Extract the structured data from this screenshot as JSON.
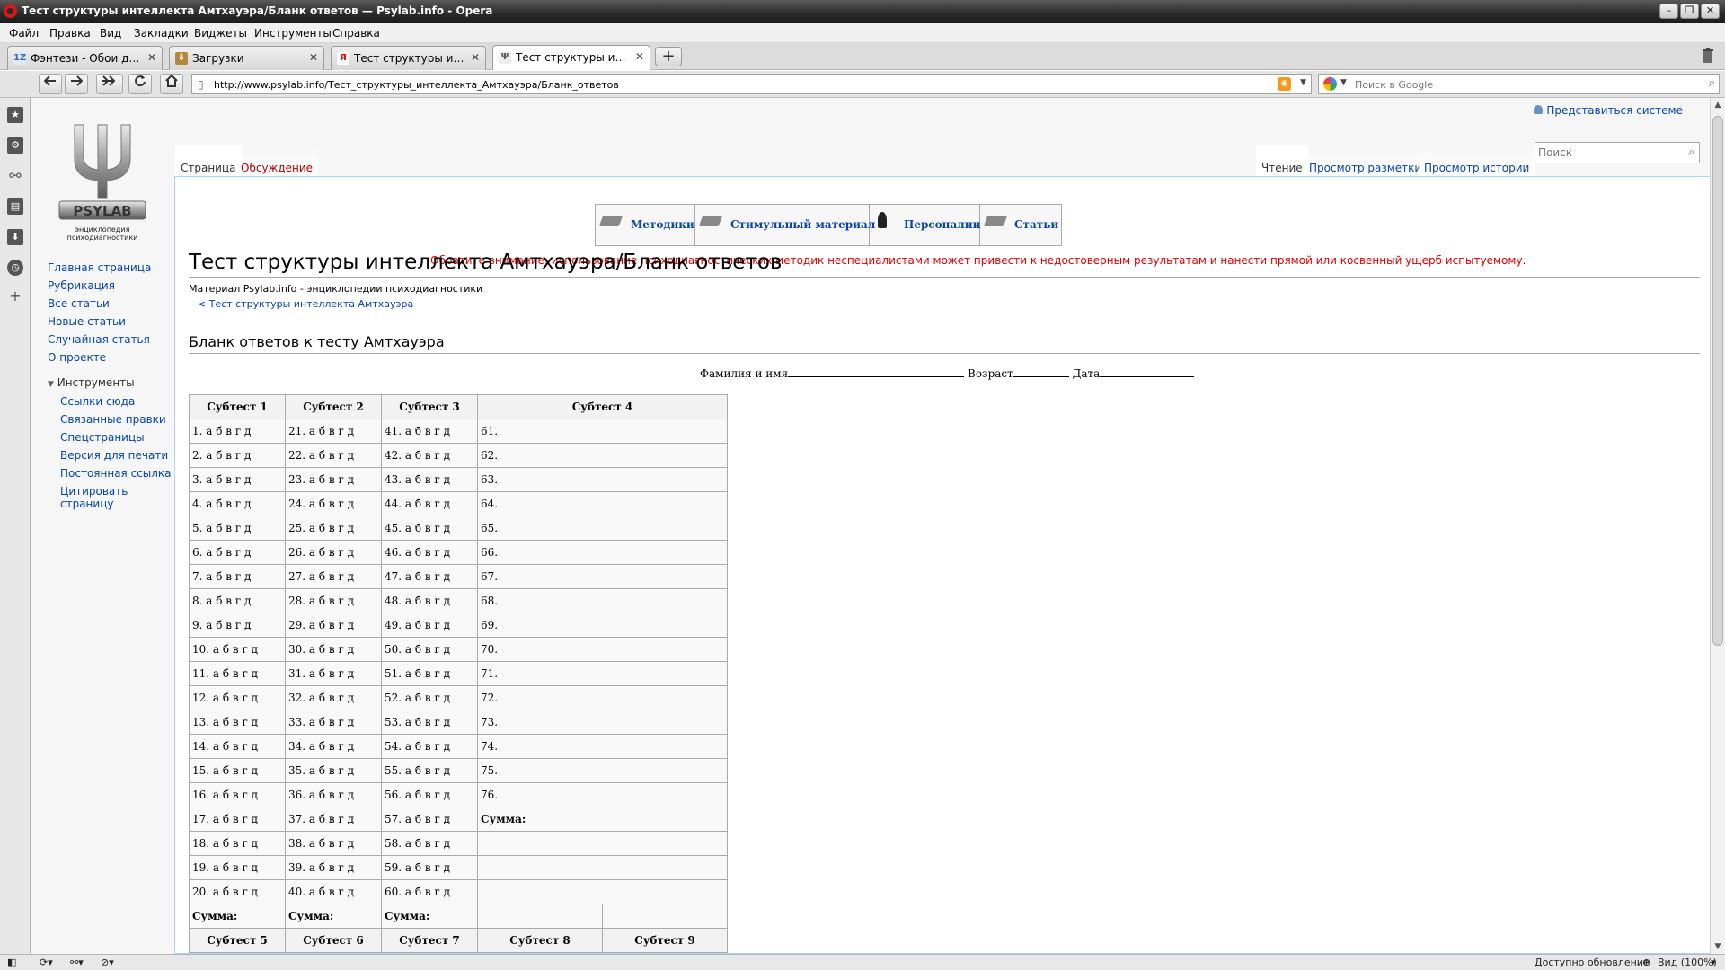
{
  "window": {
    "title": "Тест структуры интеллекта Амтхауэра/Бланк ответов — Psylab.info - Opera",
    "minimize": "–",
    "maximize": "❐",
    "close": "✕"
  },
  "menu": [
    "Файл",
    "Правка",
    "Вид",
    "Закладки",
    "Виджеты",
    "Инструменты",
    "Справка"
  ],
  "tabs": [
    {
      "label": "Фэнтези - Обои для ра...",
      "icon": "1Z",
      "close": "✕"
    },
    {
      "label": "Загрузки",
      "icon": "⬇",
      "close": "✕"
    },
    {
      "label": "Тест структуры интелл...",
      "icon": "Я",
      "close": "✕"
    },
    {
      "label": "Тест структуры интелл...",
      "icon": "Ψ",
      "close": "✕"
    }
  ],
  "new_tab": "+",
  "address": {
    "url": "http://www.psylab.info/Тест_структуры_интеллекта_Амтхауэра/Бланк_ответов",
    "search_placeholder": "Поиск в Google"
  },
  "statusbar": {
    "update": "Доступно обновление",
    "zoom": "Вид (100%)"
  },
  "site": {
    "logo_caption": "энциклопедия психодиагностики",
    "personal": "Представиться системе",
    "search_placeholder": "Поиск",
    "namespaces": [
      "Страница",
      "Обсуждение"
    ],
    "views": [
      "Чтение",
      "Просмотр разметки",
      "Просмотр истории"
    ],
    "nav": [
      "Главная страница",
      "Рубрикация",
      "Все статьи",
      "Новые статьи",
      "Случайная статья",
      "О проекте"
    ],
    "tools_heading": "Инструменты",
    "tools": [
      "Ссылки сюда",
      "Связанные правки",
      "Спецстраницы",
      "Версия для печати",
      "Постоянная ссылка",
      "Цитировать страницу"
    ],
    "categories": [
      "Методики",
      "Стимульный материал",
      "Персоналии",
      "Статьи"
    ],
    "warning": "Обратите внимание: использование психодиагностических методик неспециалистами может привести к недостоверным результатам и нанести прямой или косвенный ущерб испытуемому.",
    "title": "Тест структуры интеллекта Амтхауэра/Бланк ответов",
    "sitesub": "Материал Psylab.info - энциклопедии психодиагностики",
    "subpage": "< Тест структуры интеллекта Амтхауэра",
    "section_title": "Бланк ответов к тесту Амтхауэра",
    "form": {
      "name": "Фамилия и имя",
      "age": "Возраст",
      "date": "Дата"
    },
    "table": {
      "headers": [
        "Субтест 1",
        "Субтест 2",
        "Субтест 3",
        "Субтест 4"
      ],
      "options": "а б в г д",
      "sum_label": "Сумма:",
      "subtest4_sum": "Сумма:",
      "footer_headers": [
        "Субтест 5",
        "Субтест 6",
        "Субтест 7",
        "Субтест 8",
        "Субтест 9"
      ]
    }
  }
}
